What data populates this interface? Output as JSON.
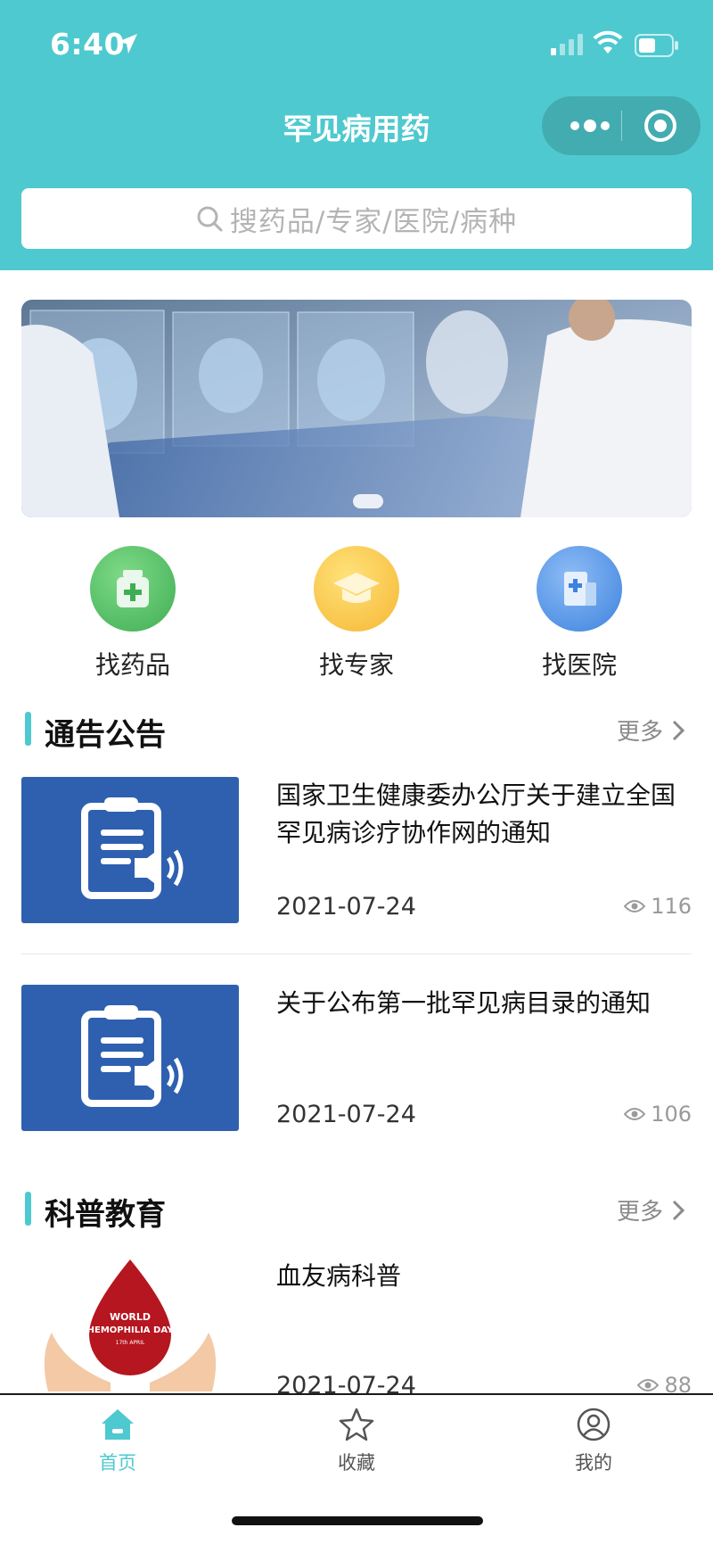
{
  "status_bar": {
    "time": "6:40"
  },
  "nav": {
    "title": "罕见病用药"
  },
  "search": {
    "placeholder": "搜药品/专家/医院/病种"
  },
  "quick_entries": [
    {
      "label": "找药品",
      "icon": "medicine-icon"
    },
    {
      "label": "找专家",
      "icon": "graduation-cap-icon"
    },
    {
      "label": "找医院",
      "icon": "hospital-icon"
    }
  ],
  "announcements": {
    "title": "通告公告",
    "more_label": "更多",
    "items": [
      {
        "title": "国家卫生健康委办公厅关于建立全国罕见病诊疗协作网的通知",
        "date": "2021-07-24",
        "views": "116"
      },
      {
        "title": "关于公布第一批罕见病目录的通知",
        "date": "2021-07-24",
        "views": "106"
      }
    ]
  },
  "education": {
    "title": "科普教育",
    "more_label": "更多",
    "items": [
      {
        "title": "血友病科普",
        "date": "2021-07-24",
        "views": "88",
        "image_text": [
          "WORLD",
          "HEMOPHILIA DAY",
          "17th APRIL"
        ]
      }
    ]
  },
  "tabbar": {
    "home_label": "首页",
    "favorites_label": "收藏",
    "mine_label": "我的"
  },
  "colors": {
    "accent": "#4ec9cf",
    "notice_thumb": "#2f60b0"
  }
}
